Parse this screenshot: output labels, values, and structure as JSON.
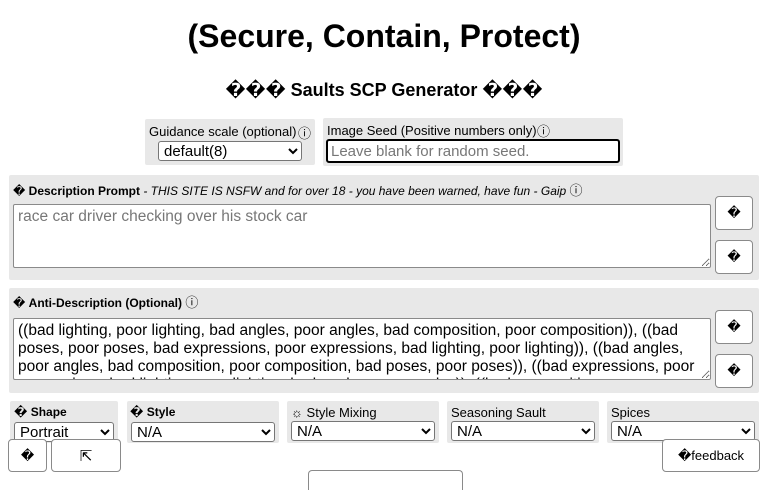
{
  "header": {
    "title": "(Secure, Contain, Protect)",
    "subtitle": "��� Saults SCP Generator ���"
  },
  "guidance": {
    "label": "Guidance scale (optional)",
    "info_icon": "ⓘ",
    "selected": "default(8)"
  },
  "seed": {
    "label": "Image Seed (Positive numbers only)",
    "info_icon": "ⓘ",
    "placeholder": "Leave blank for random seed."
  },
  "description": {
    "glyph": "�",
    "label": "Description Prompt",
    "note": " - THIS SITE IS NSFW and for over 18 - you have been warned, have fun - Gaip ",
    "info_icon": "ⓘ",
    "placeholder": "race car driver checking over his stock car",
    "button1": "�",
    "button2": "�"
  },
  "anti": {
    "glyph": "�",
    "label": "Anti-Description (",
    "label_optional": "Optional",
    "label_end": ") ",
    "info_icon": "ⓘ",
    "value": "((bad lighting, poor lighting, bad angles, poor angles, bad composition, poor composition)), ((bad poses, poor poses, bad expressions, poor expressions, bad lighting, poor lighting)), ((bad angles, poor angles, bad composition, poor composition, bad poses, poor poses)), ((bad expressions, poor expressions, bad lighting, poor lighting, bad angles, poor angles)), ((bad composition, poor composition",
    "button1": "�",
    "button2": "�"
  },
  "options": {
    "shape": {
      "glyph": "�",
      "label": "Shape",
      "selected": "Portrait"
    },
    "style": {
      "glyph": "�",
      "label": "Style",
      "selected": "N/A"
    },
    "mixing": {
      "glyph": "☼",
      "label": "Style Mixing",
      "selected": "N/A"
    },
    "seasoning": {
      "label": "Seasoning Sault",
      "selected": "N/A"
    },
    "spices": {
      "label": "Spices",
      "selected": "N/A"
    }
  },
  "floating": {
    "left_button": "�",
    "expand_icon": "⇱",
    "feedback_glyph": "�",
    "feedback_label": " feedback"
  }
}
